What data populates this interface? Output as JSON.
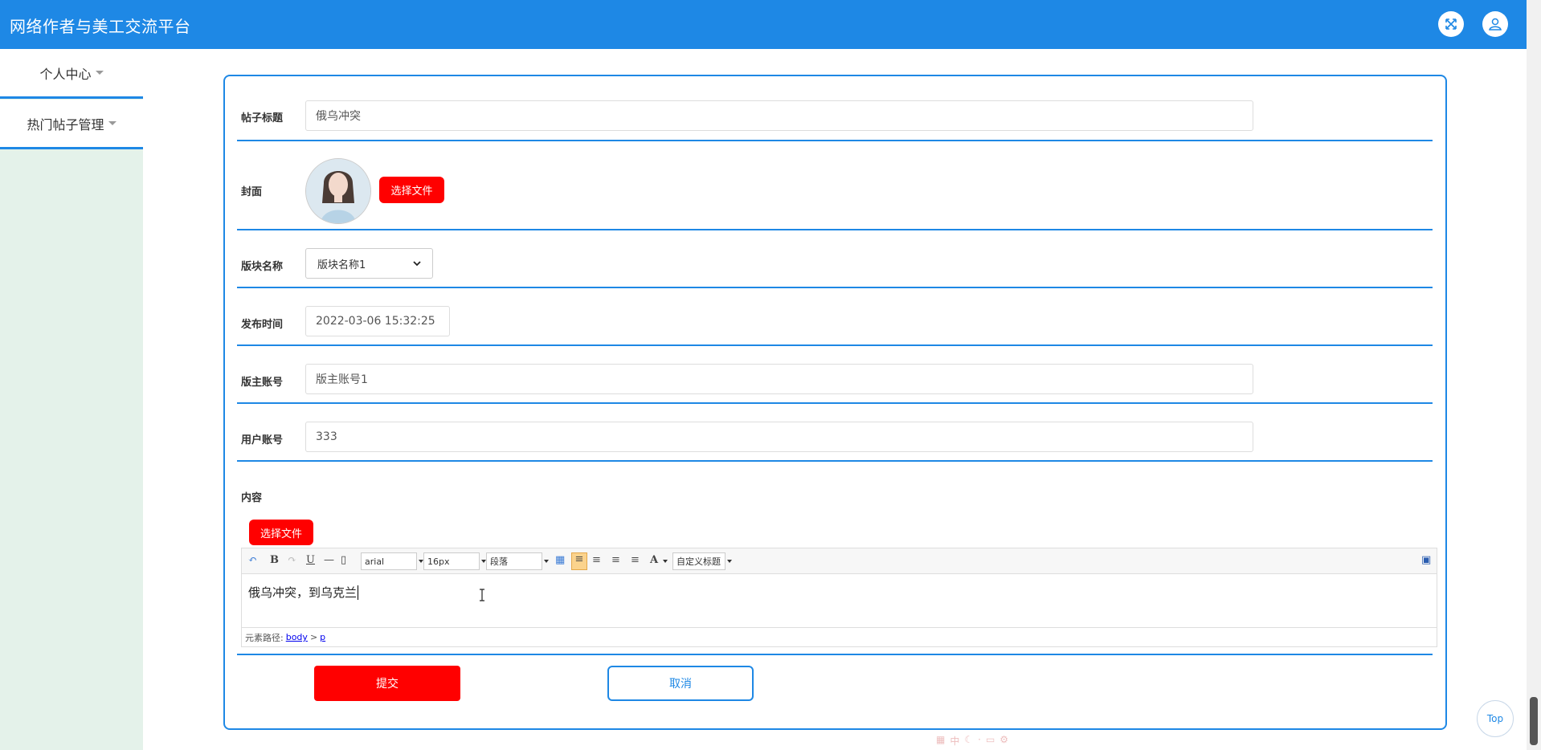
{
  "header": {
    "title": "网络作者与美工交流平台"
  },
  "sidebar": {
    "items": [
      {
        "label": "个人中心"
      },
      {
        "label": "热门帖子管理"
      }
    ]
  },
  "form": {
    "title_label": "帖子标题",
    "title_value": "俄乌冲突",
    "cover_label": "封面",
    "cover_button": "选择文件",
    "section_label": "版块名称",
    "section_value": "版块名称1",
    "publish_label": "发布时间",
    "publish_value": "2022-03-06 15:32:25",
    "moderator_label": "版主账号",
    "moderator_value": "版主账号1",
    "user_label": "用户账号",
    "user_value": "333",
    "content_label": "内容",
    "content_button": "选择文件"
  },
  "editor": {
    "font": "arial",
    "size": "16px",
    "paragraph": "段落",
    "custom_title": "自定义标题",
    "content": "俄乌冲突，到乌克兰",
    "path_label": "元素路径:",
    "path": [
      "body",
      "p"
    ],
    "path_sep": ">"
  },
  "actions": {
    "submit": "提交",
    "cancel": "取消",
    "top": "Top"
  },
  "ime": {
    "text": "中"
  },
  "colors": {
    "primary": "#1e88e5",
    "danger": "#ff0000",
    "sidebar_bg": "#e4f2ea"
  }
}
